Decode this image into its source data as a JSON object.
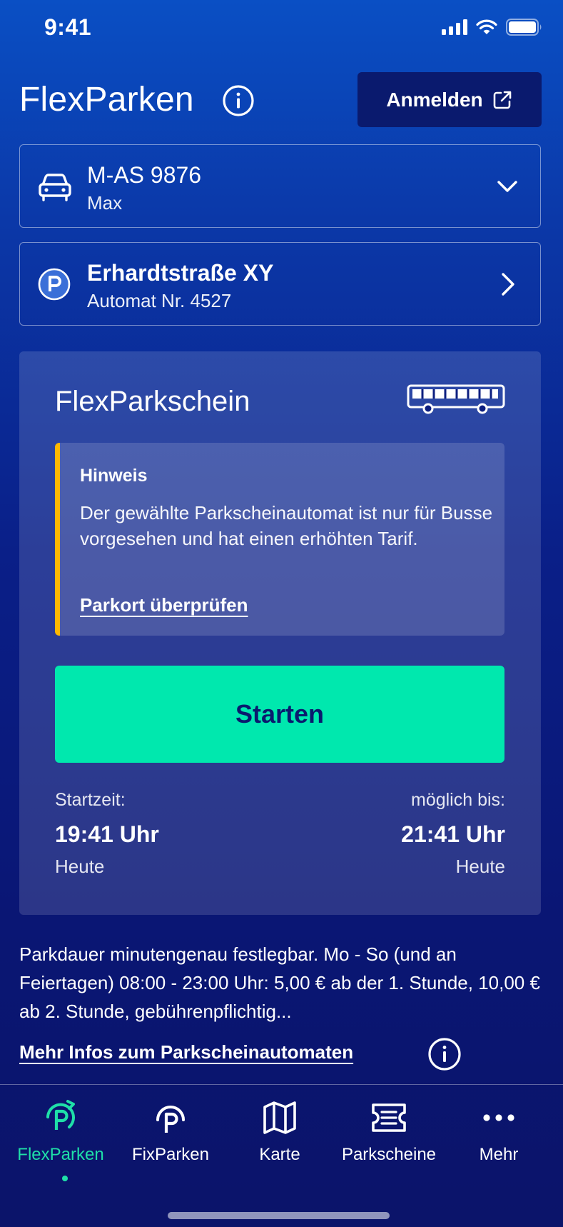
{
  "status_bar": {
    "time": "9:41"
  },
  "header": {
    "title": "FlexParken",
    "login_label": "Anmelden"
  },
  "vehicle": {
    "plate": "M-AS 9876",
    "owner": "Max"
  },
  "location": {
    "street": "Erhardtstraße XY",
    "machine": "Automat Nr. 4527"
  },
  "card": {
    "title": "FlexParkschein",
    "notice": {
      "title": "Hinweis",
      "text": "Der gewählte Parkscheinautomat ist nur für Busse vorgesehen und hat einen erhöhten Tarif.",
      "link": "Parkort überprüfen"
    },
    "start_label": "Starten",
    "start_time": {
      "label": "Startzeit:",
      "value": "19:41 Uhr",
      "day": "Heute"
    },
    "end_time": {
      "label": "möglich bis:",
      "value": "21:41 Uhr",
      "day": "Heute"
    }
  },
  "tariff": {
    "text": "Parkdauer minutengenau festlegbar. Mo - So (und an Feiertagen) 08:00 - 23:00 Uhr: 5,00 € ab der 1. Stunde, 10,00 € ab 2. Stunde, gebührenpflichtig...",
    "link": "Mehr Infos zum Parkscheinautomaten"
  },
  "tabs": [
    {
      "label": "FlexParken",
      "icon": "flexparken-icon",
      "active": true
    },
    {
      "label": "FixParken",
      "icon": "fixparken-icon",
      "active": false
    },
    {
      "label": "Karte",
      "icon": "map-icon",
      "active": false
    },
    {
      "label": "Parkscheine",
      "icon": "ticket-icon",
      "active": false
    },
    {
      "label": "Mehr",
      "icon": "more-icon",
      "active": false
    }
  ],
  "colors": {
    "accent": "#00e8ae",
    "active_tab": "#1fe0a8",
    "notice_border": "#ffb800",
    "button_dark": "#0a1a6e"
  }
}
